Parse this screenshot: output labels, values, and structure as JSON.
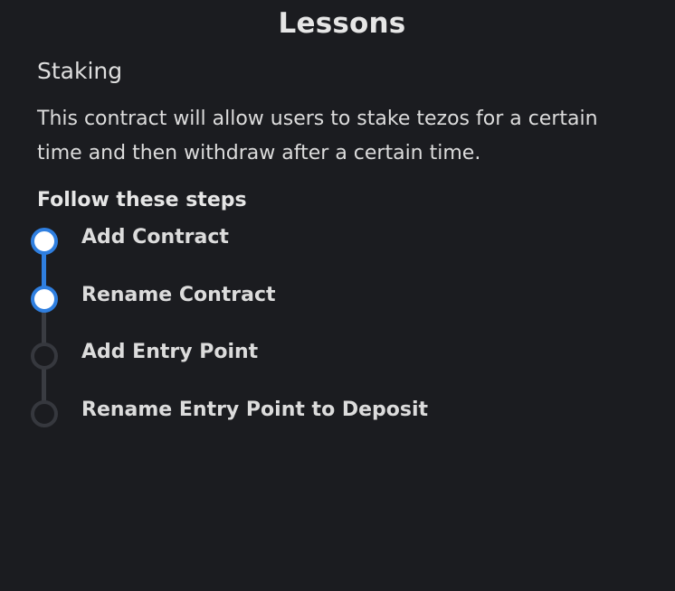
{
  "panel": {
    "title": "Lessons",
    "lesson_name": "Staking",
    "lesson_description": "This contract will allow users to stake tezos for a certain time and then withdraw after a certain time.",
    "steps_heading": "Follow these steps"
  },
  "steps": [
    {
      "label": "Add Contract",
      "completed": true
    },
    {
      "label": "Rename Contract",
      "completed": true
    },
    {
      "label": "Add Entry Point",
      "completed": false
    },
    {
      "label": "Rename Entry Point to Deposit",
      "completed": false
    }
  ],
  "colors": {
    "background": "#1b1c20",
    "completed": "#2f7fe0",
    "pending": "#36383e",
    "text": "#e6e6e6"
  }
}
